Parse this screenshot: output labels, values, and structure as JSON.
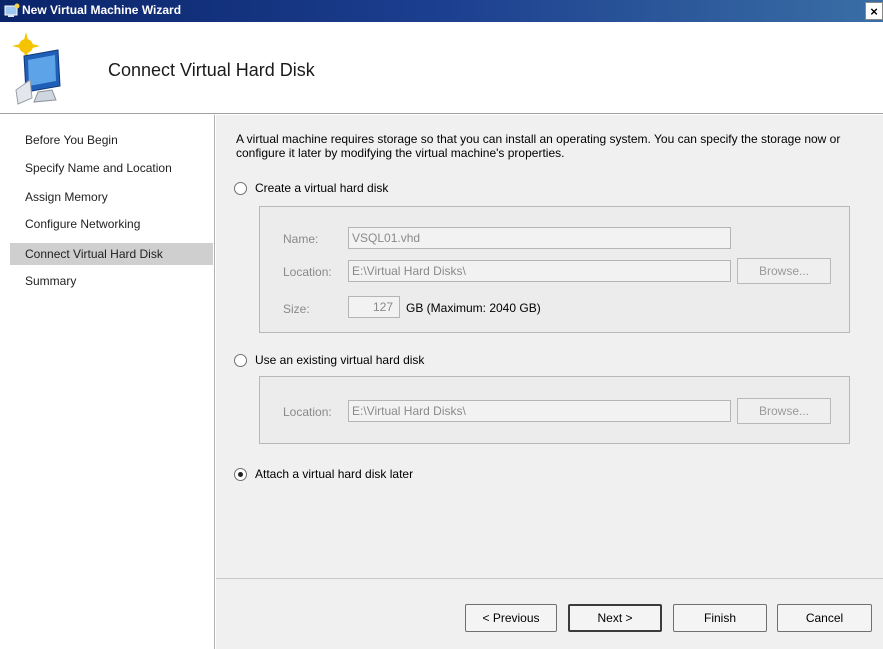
{
  "window": {
    "title": "New Virtual Machine Wizard",
    "close_label": "×"
  },
  "header": {
    "heading": "Connect Virtual Hard Disk"
  },
  "sidebar": {
    "steps": [
      {
        "label": "Before You Begin"
      },
      {
        "label": "Specify Name and Location"
      },
      {
        "label": "Assign Memory"
      },
      {
        "label": "Configure Networking"
      },
      {
        "label": "Connect Virtual Hard Disk"
      },
      {
        "label": "Summary"
      }
    ],
    "active_step": "Connect Virtual Hard Disk"
  },
  "main": {
    "intro": "A virtual machine requires storage so that you can install an operating system. You can specify the storage now or configure it later by modifying the virtual machine's properties.",
    "options": {
      "create": {
        "label": "Create a virtual hard disk",
        "checked": false,
        "name_label": "Name:",
        "name_value": "VSQL01.vhd",
        "location_label": "Location:",
        "location_value": "E:\\Virtual Hard Disks\\",
        "browse_label": "Browse...",
        "size_label": "Size:",
        "size_value": "127",
        "size_suffix": "GB (Maximum: 2040 GB)"
      },
      "existing": {
        "label": "Use an existing virtual hard disk",
        "checked": false,
        "location_label": "Location:",
        "location_value": "E:\\Virtual Hard Disks\\",
        "browse_label": "Browse..."
      },
      "later": {
        "label": "Attach a virtual hard disk later",
        "checked": true
      }
    }
  },
  "footer": {
    "previous_label": "< Previous",
    "next_label": "Next >",
    "finish_label": "Finish",
    "cancel_label": "Cancel"
  }
}
